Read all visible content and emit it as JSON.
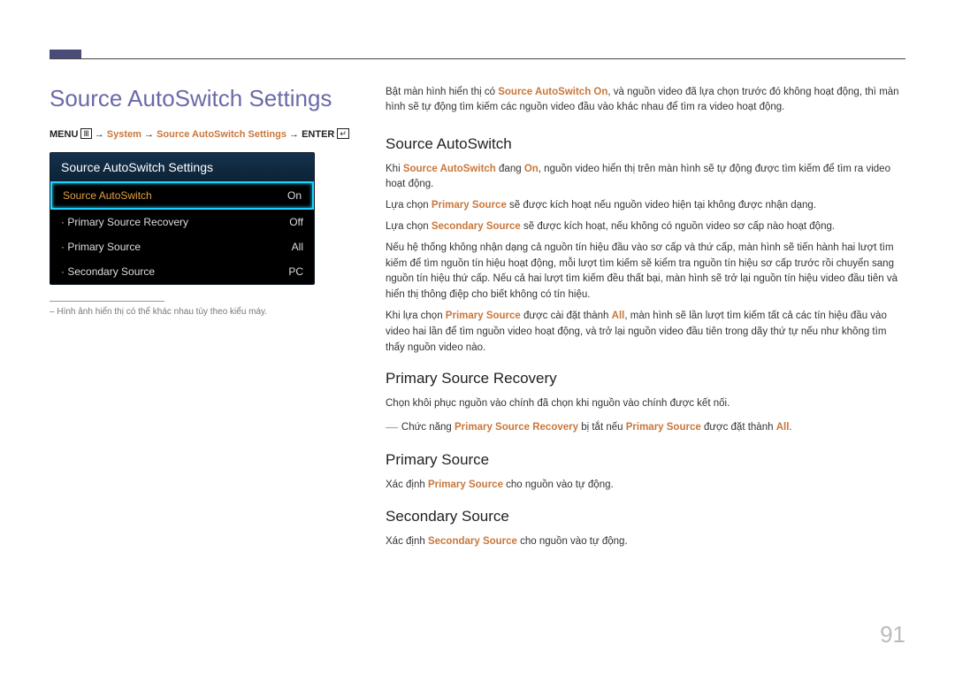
{
  "page": {
    "number": "91",
    "title": "Source AutoSwitch Settings"
  },
  "breadcrumb": {
    "menu": "MENU",
    "arrow": " → ",
    "system": "System",
    "settings": "Source AutoSwitch Settings",
    "enter": "ENTER"
  },
  "menu": {
    "header": "Source AutoSwitch Settings",
    "rows": [
      {
        "label": "Source AutoSwitch",
        "value": "On",
        "highlight": true
      },
      {
        "label": "Primary Source Recovery",
        "value": "Off"
      },
      {
        "label": "Primary Source",
        "value": "All"
      },
      {
        "label": "Secondary Source",
        "value": "PC"
      }
    ]
  },
  "note": "Hình ảnh hiển thị có thể khác nhau tùy theo kiểu máy.",
  "intro": {
    "p1a": "Bật màn hình hiển thị có ",
    "p1b": "Source AutoSwitch On",
    "p1c": ", và nguồn video đã lựa chọn trước đó không hoạt động, thì màn hình sẽ tự động tìm kiếm các nguồn video đầu vào khác nhau để tìm ra video hoạt động."
  },
  "sections": {
    "s1": {
      "title": "Source AutoSwitch",
      "p1a": "Khi ",
      "p1b": "Source AutoSwitch",
      "p1c": " đang ",
      "p1d": "On",
      "p1e": ", nguồn video hiển thị trên màn hình sẽ tự động được tìm kiếm để tìm ra video hoạt động.",
      "p2a": "Lựa chọn ",
      "p2b": "Primary Source",
      "p2c": " sẽ được kích hoạt nếu nguồn video hiện tại không được nhận dạng.",
      "p3a": "Lựa chọn ",
      "p3b": "Secondary Source",
      "p3c": " sẽ được kích hoạt, nếu không có nguồn video sơ cấp nào hoạt động.",
      "p4": "Nếu hệ thống không nhận dạng cả nguồn tín hiệu đầu vào sơ cấp và thứ cấp, màn hình sẽ tiến hành hai lượt tìm kiếm để tìm nguồn tín hiệu hoạt động, mỗi lượt tìm kiếm sẽ kiểm tra nguồn tín hiệu sơ cấp trước rồi chuyển sang nguồn tín hiệu thứ cấp. Nếu cả hai lượt tìm kiếm đều thất bại, màn hình sẽ trở lại nguồn tín hiệu video đầu tiên và hiển thị thông điệp cho biết không có tín hiệu.",
      "p5a": "Khi lựa chọn ",
      "p5b": "Primary Source",
      "p5c": " được cài đặt thành ",
      "p5d": "All",
      "p5e": ", màn hình sẽ lần lượt tìm kiếm tất cả các tín hiệu đầu vào video hai lần để tìm nguồn video hoạt động, và trở lại nguồn video đầu tiên trong dãy thứ tự nếu như không tìm thấy nguồn video nào."
    },
    "s2": {
      "title": "Primary Source Recovery",
      "p1": "Chọn khôi phục nguồn vào chính đã chọn khi nguồn vào chính được kết nối.",
      "note_a": "Chức năng ",
      "note_b": "Primary Source Recovery",
      "note_c": " bị tắt nếu ",
      "note_d": "Primary Source",
      "note_e": " được đặt thành ",
      "note_f": "All",
      "note_g": "."
    },
    "s3": {
      "title": "Primary Source",
      "p1a": "Xác định ",
      "p1b": "Primary Source",
      "p1c": " cho nguồn vào tự động."
    },
    "s4": {
      "title": "Secondary Source",
      "p1a": "Xác định ",
      "p1b": "Secondary Source",
      "p1c": " cho nguồn vào tự động."
    }
  }
}
